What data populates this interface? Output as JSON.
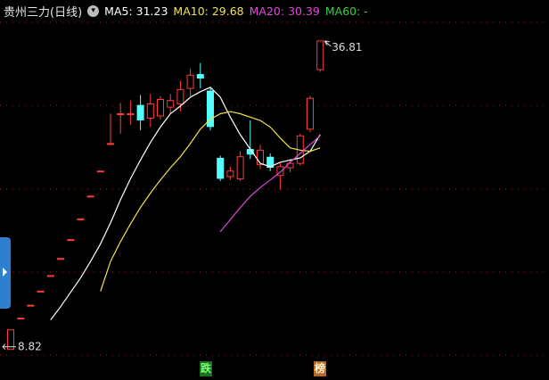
{
  "header": {
    "title": "贵州三力(日线)",
    "ma5_label": "MA5: 31.23",
    "ma10_label": "MA10: 29.68",
    "ma20_label": "MA20: 30.39",
    "ma60_label": "MA60: -"
  },
  "markers": {
    "down": "跌",
    "list": "榜"
  },
  "colors": {
    "up": "#ff3b3b",
    "down": "#54ffff",
    "ma5": "#ffffff",
    "ma10": "#f2e24b",
    "ma20": "#e04ad6",
    "ma60": "#34d04a"
  },
  "chart_data": {
    "type": "candlestick",
    "high_annotation": "36.81",
    "low_annotation": "8.82",
    "ylim": [
      7.5,
      38.5
    ],
    "candles": [
      {
        "o": 8.82,
        "c": 10.6,
        "h": 10.6,
        "l": 8.82
      },
      {
        "o": 11.66,
        "c": 11.66,
        "h": 11.66,
        "l": 11.66
      },
      {
        "o": 12.83,
        "c": 12.83,
        "h": 12.83,
        "l": 12.83
      },
      {
        "o": 14.11,
        "c": 14.11,
        "h": 14.11,
        "l": 14.11
      },
      {
        "o": 15.52,
        "c": 15.52,
        "h": 15.52,
        "l": 15.52
      },
      {
        "o": 17.07,
        "c": 17.07,
        "h": 17.07,
        "l": 17.07
      },
      {
        "o": 18.78,
        "c": 18.78,
        "h": 18.78,
        "l": 18.78
      },
      {
        "o": 20.66,
        "c": 20.66,
        "h": 20.66,
        "l": 20.66
      },
      {
        "o": 22.73,
        "c": 22.73,
        "h": 22.73,
        "l": 22.73
      },
      {
        "o": 25.0,
        "c": 25.0,
        "h": 25.0,
        "l": 25.0
      },
      {
        "o": 27.5,
        "c": 27.5,
        "h": 30.2,
        "l": 27.5
      },
      {
        "o": 30.2,
        "c": 30.2,
        "h": 31.2,
        "l": 28.4
      },
      {
        "o": 30.2,
        "c": 30.2,
        "h": 31.4,
        "l": 29.2
      },
      {
        "o": 31.0,
        "c": 29.6,
        "h": 31.9,
        "l": 28.7
      },
      {
        "o": 29.8,
        "c": 31.1,
        "h": 32.0,
        "l": 29.0
      },
      {
        "o": 30.0,
        "c": 31.5,
        "h": 31.8,
        "l": 29.7
      },
      {
        "o": 30.8,
        "c": 31.4,
        "h": 32.0,
        "l": 30.2
      },
      {
        "o": 31.1,
        "c": 32.4,
        "h": 33.2,
        "l": 30.4
      },
      {
        "o": 32.5,
        "c": 33.7,
        "h": 34.3,
        "l": 31.8
      },
      {
        "o": 33.8,
        "c": 33.4,
        "h": 34.8,
        "l": 32.5
      },
      {
        "o": 32.3,
        "c": 29.0,
        "h": 32.6,
        "l": 28.7
      },
      {
        "o": 26.2,
        "c": 24.3,
        "h": 26.4,
        "l": 24.1
      },
      {
        "o": 24.5,
        "c": 25.0,
        "h": 25.4,
        "l": 24.2
      },
      {
        "o": 24.3,
        "c": 26.3,
        "h": 26.8,
        "l": 24.1
      },
      {
        "o": 27.0,
        "c": 26.5,
        "h": 29.6,
        "l": 26.1
      },
      {
        "o": 25.6,
        "c": 26.9,
        "h": 27.4,
        "l": 25.2
      },
      {
        "o": 26.3,
        "c": 25.3,
        "h": 26.6,
        "l": 25.0
      },
      {
        "o": 24.6,
        "c": 25.4,
        "h": 25.8,
        "l": 23.3
      },
      {
        "o": 25.3,
        "c": 25.7,
        "h": 26.1,
        "l": 24.9
      },
      {
        "o": 25.7,
        "c": 28.2,
        "h": 28.4,
        "l": 25.5
      },
      {
        "o": 28.8,
        "c": 31.6,
        "h": 31.8,
        "l": 28.5
      },
      {
        "o": 34.2,
        "c": 36.81,
        "h": 36.81,
        "l": 34.0
      }
    ],
    "ma5": [
      null,
      null,
      null,
      null,
      11.5,
      12.7,
      14.0,
      15.3,
      16.8,
      18.4,
      20.3,
      22.4,
      24.3,
      26.0,
      27.6,
      29.0,
      30.2,
      30.9,
      31.7,
      32.2,
      32.6,
      31.7,
      29.9,
      28.3,
      27.0,
      25.7,
      25.4,
      25.8,
      26.0,
      26.2,
      26.8,
      28.3
    ],
    "ma10": [
      null,
      null,
      null,
      null,
      null,
      null,
      null,
      null,
      null,
      14.1,
      16.8,
      18.6,
      20.2,
      21.7,
      23.0,
      24.2,
      25.3,
      26.3,
      27.5,
      28.8,
      29.7,
      30.2,
      30.4,
      30.2,
      29.9,
      29.6,
      29.0,
      28.0,
      27.1,
      26.9,
      26.8,
      27.1
    ],
    "ma20": [
      null,
      null,
      null,
      null,
      null,
      null,
      null,
      null,
      null,
      null,
      null,
      null,
      null,
      null,
      null,
      null,
      null,
      null,
      null,
      null,
      null,
      19.5,
      20.6,
      21.7,
      22.7,
      23.5,
      24.2,
      24.9,
      25.8,
      26.6,
      27.4,
      28.2
    ],
    "ma60": []
  }
}
